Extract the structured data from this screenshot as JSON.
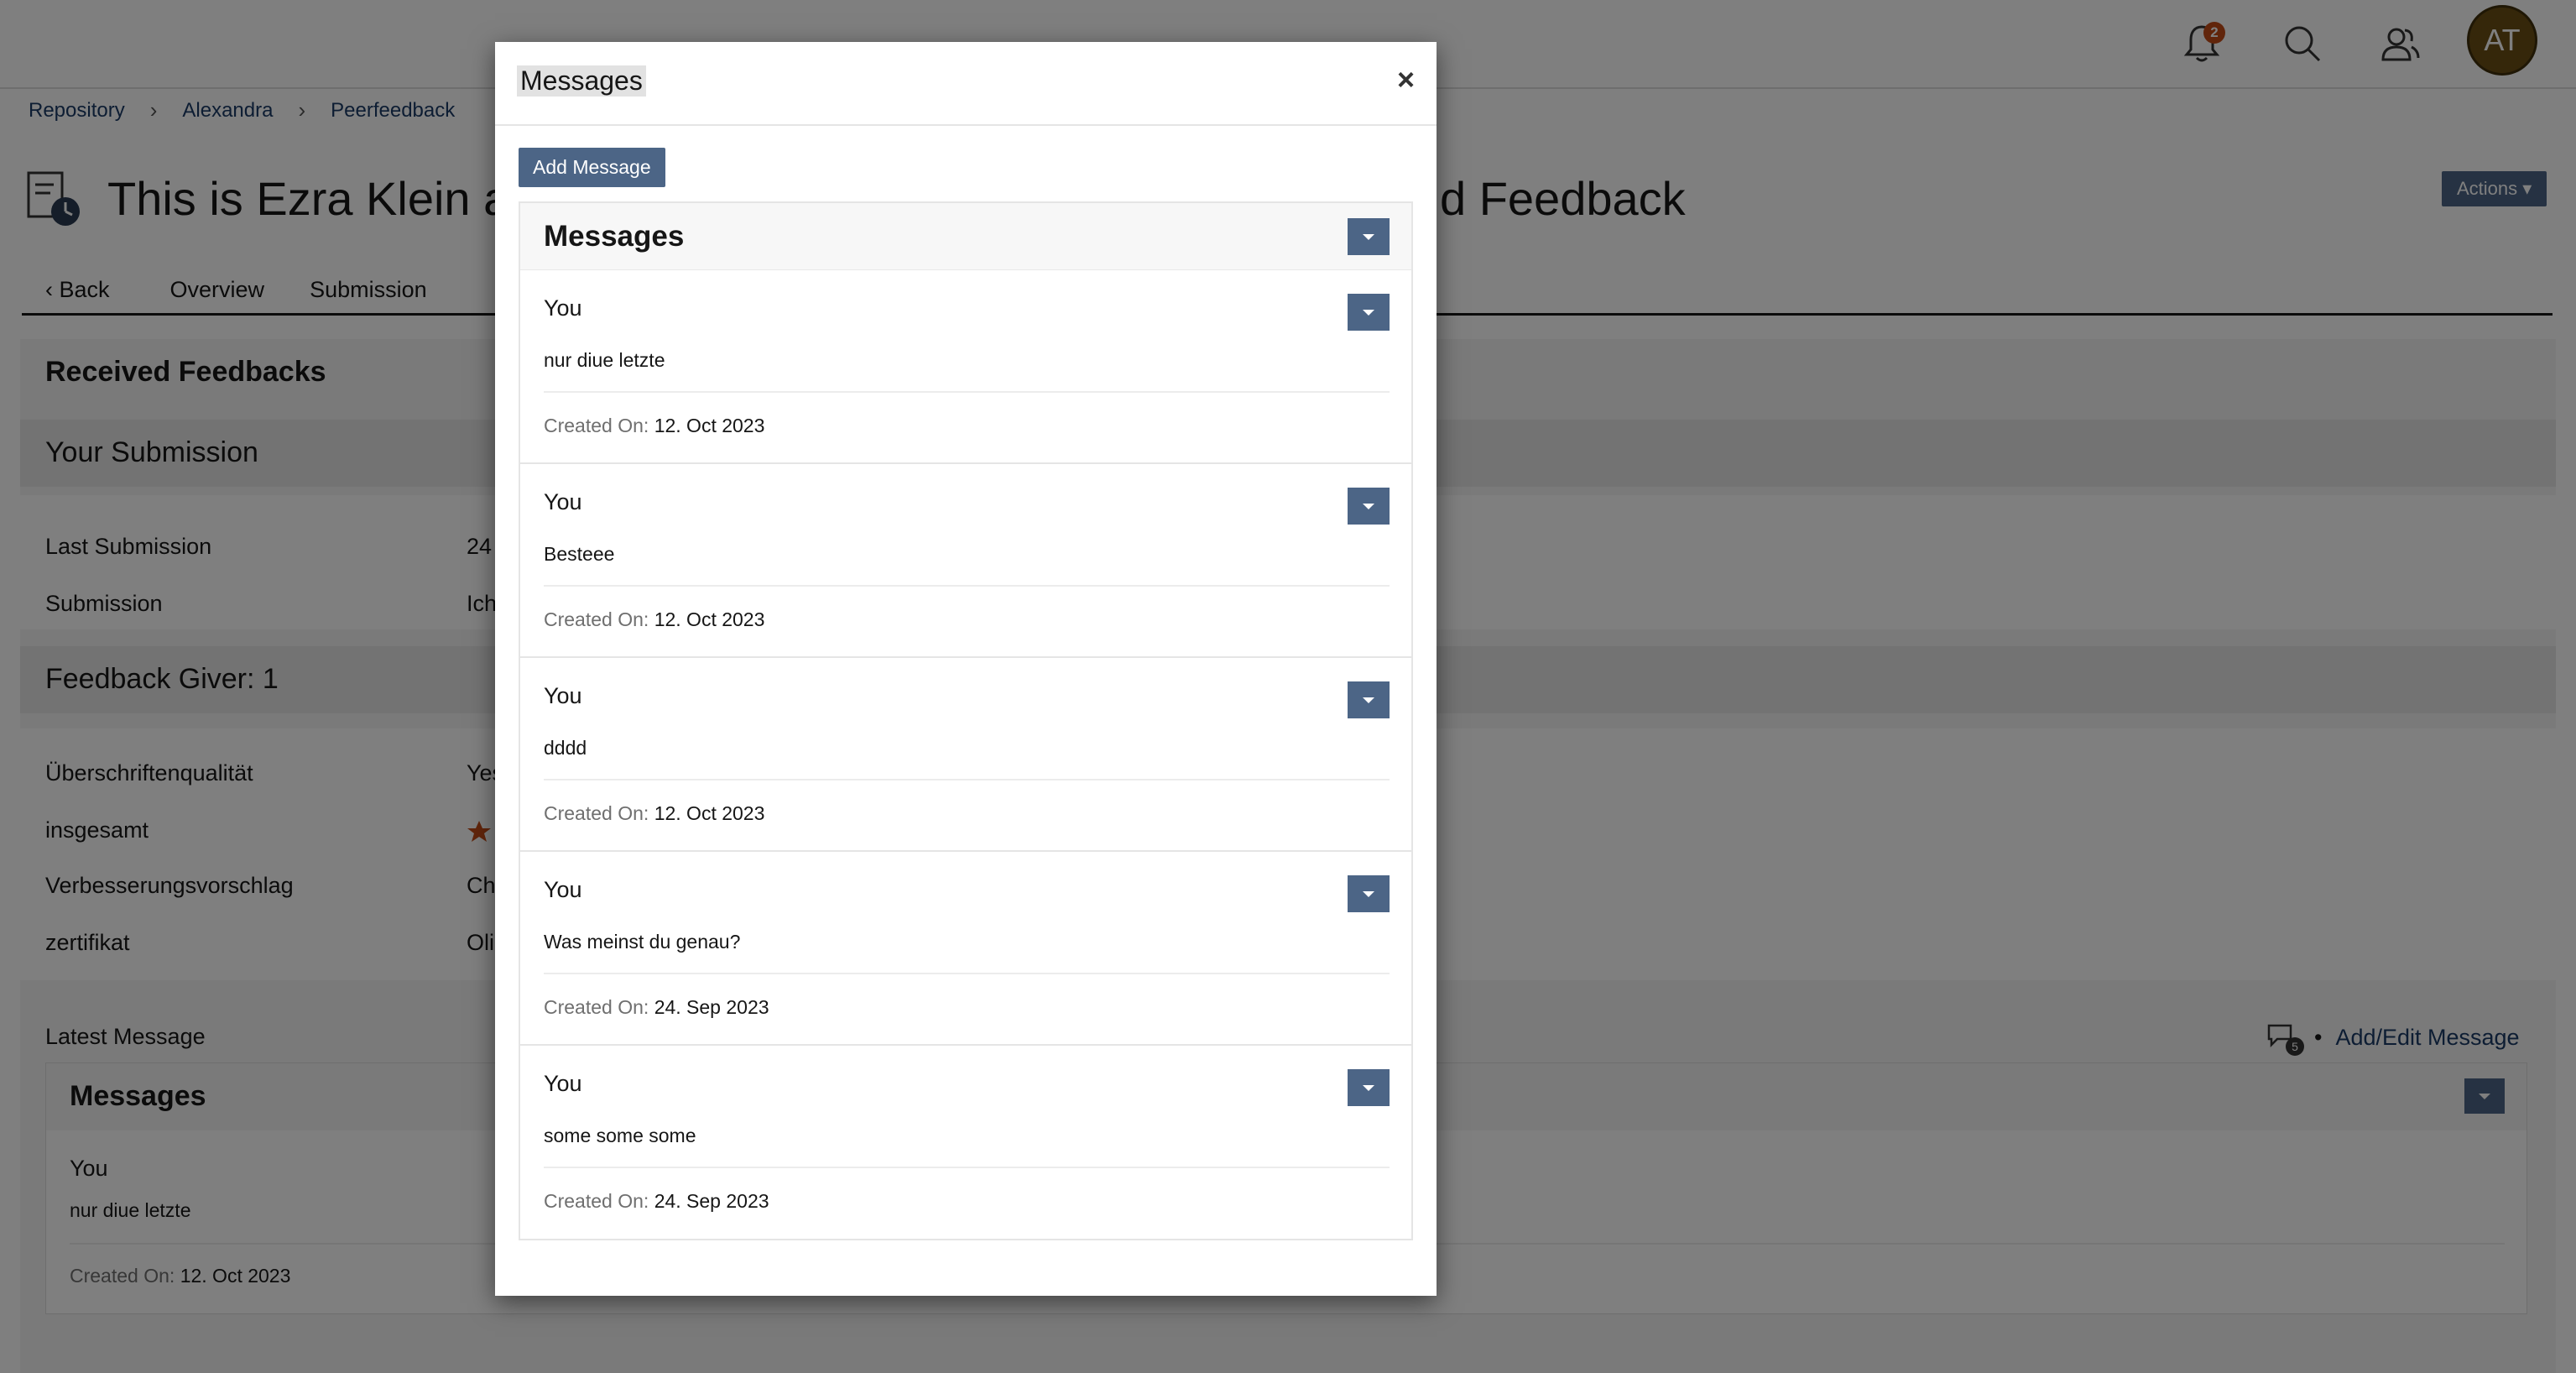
{
  "header": {
    "notifications_count": "2",
    "avatar_initials": "AT"
  },
  "breadcrumb": [
    "Repository",
    "Alexandra",
    "Peerfeedback"
  ],
  "page": {
    "title_visible_left": "This is Ezra Klein a",
    "title_visible_right": "d Feedback",
    "actions_label": "Actions"
  },
  "tabs": [
    {
      "label": "Back"
    },
    {
      "label": "Overview"
    },
    {
      "label": "Submission"
    }
  ],
  "received": {
    "title": "Received Feedbacks",
    "your_submission": "Your Submission",
    "last_submission_label": "Last Submission",
    "last_submission_value": "24",
    "submission_label": "Submission",
    "submission_value": "Ich",
    "feedback_giver": "Feedback Giver: 1",
    "ueberschrift_label": "Überschriftenqualität",
    "ueberschrift_value": "Yes",
    "insgesamt_label": "insgesamt",
    "verbesserung_label": "Verbesserungsvorschlag",
    "verbesserung_value": "Ch",
    "zertifikat_label": "zertifikat",
    "zertifikat_value": "Oli"
  },
  "latest": {
    "label": "Latest Message",
    "count": "5",
    "add_edit_label": "Add/Edit Message",
    "panel_title": "Messages",
    "author": "You",
    "body": "nur diue letzte",
    "created_label": "Created On:",
    "created_value": "12. Oct 2023"
  },
  "modal": {
    "title": "Messages",
    "close": "×",
    "add_button": "Add Message",
    "list_title": "Messages",
    "created_label": "Created On:",
    "messages": [
      {
        "author": "You",
        "body": "nur diue letzte",
        "date": "12. Oct 2023"
      },
      {
        "author": "You",
        "body": "Besteee",
        "date": "12. Oct 2023"
      },
      {
        "author": "You",
        "body": "dddd",
        "date": "12. Oct 2023"
      },
      {
        "author": "You",
        "body": "Was meinst du genau?",
        "date": "24. Sep 2023"
      },
      {
        "author": "You",
        "body": "some some some",
        "date": "24. Sep 2023"
      }
    ]
  },
  "colors": {
    "primary_button": "#4c6586",
    "notification_badge": "#c24a16",
    "star": "#c24a16",
    "avatar": "#6b4e14"
  }
}
